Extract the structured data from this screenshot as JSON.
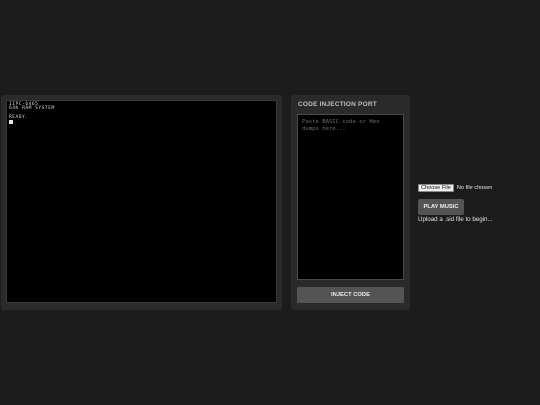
{
  "emulator": {
    "lines": [
      "IIPC-6465",
      "64K RAM SYSTEM",
      "",
      "READY."
    ]
  },
  "inject": {
    "title": "CODE INJECTION PORT",
    "placeholder": "Paste BASIC code or Hex dumps here...",
    "value": "",
    "button_label": "INJECT CODE"
  },
  "music": {
    "choose_file_label": "Choose File",
    "no_file_text": "No file chosen",
    "play_label": "PLAY MUSIC",
    "status": "Upload a .sid file to begin..."
  }
}
